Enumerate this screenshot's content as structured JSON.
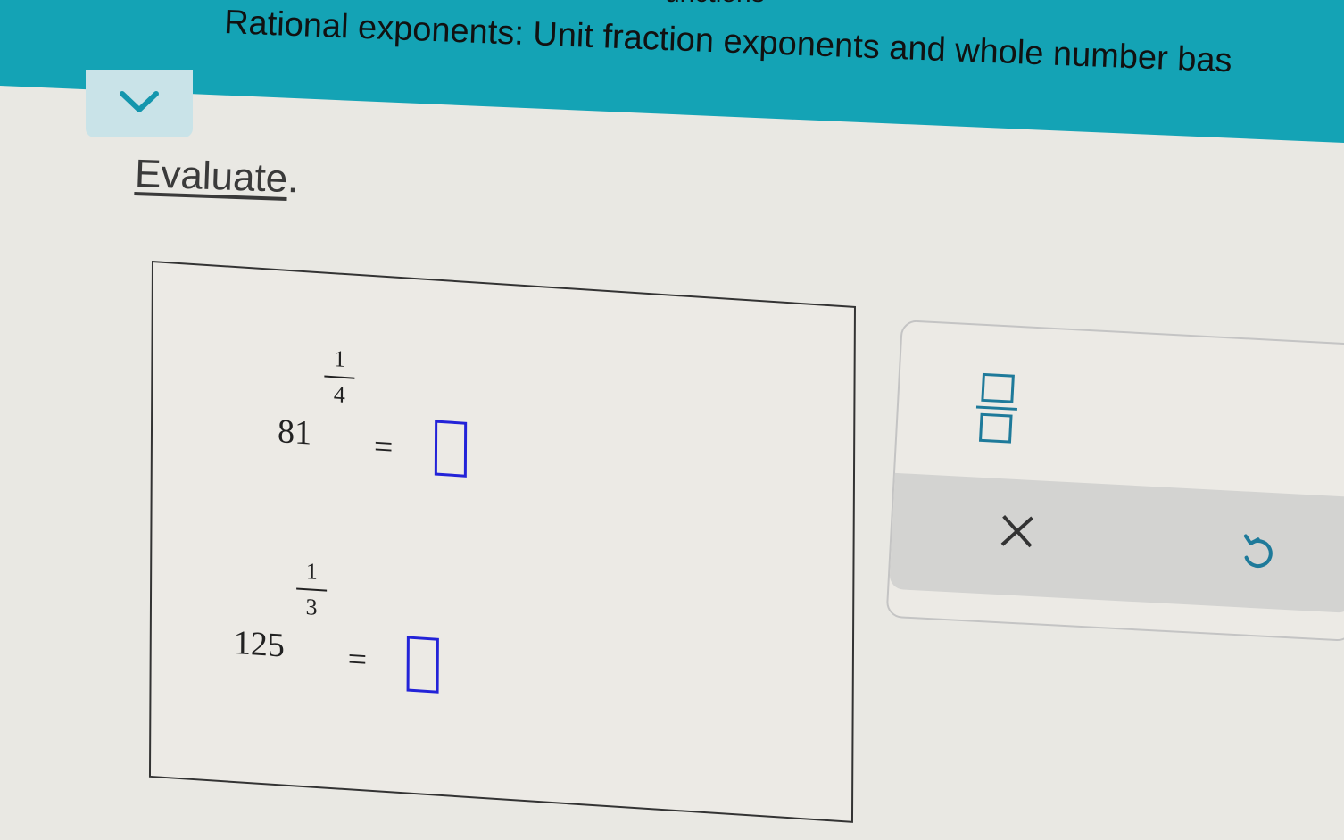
{
  "header": {
    "category_peek": "unctions",
    "title": "Rational exponents: Unit fraction exponents and whole number bas",
    "accent_color": "#14a3b5"
  },
  "instruction": {
    "word": "Evaluate",
    "period": "."
  },
  "problems": [
    {
      "base": "81",
      "exp_num": "1",
      "exp_den": "4",
      "equals": "="
    },
    {
      "base": "125",
      "exp_num": "1",
      "exp_den": "3",
      "equals": "="
    }
  ],
  "icons": {
    "collapse": "chevron-down-icon",
    "fraction": "fraction-template-icon",
    "clear": "close-icon",
    "undo": "undo-icon"
  }
}
